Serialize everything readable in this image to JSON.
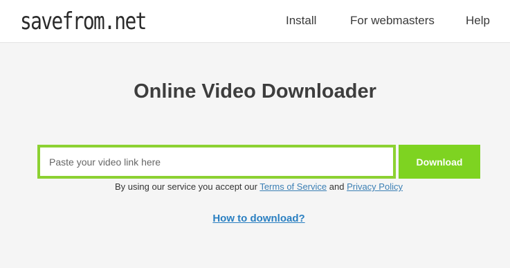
{
  "header": {
    "logo": "savefrom.net",
    "nav": [
      {
        "label": "Install"
      },
      {
        "label": "For webmasters"
      },
      {
        "label": "Help"
      }
    ]
  },
  "main": {
    "title": "Online Video Downloader",
    "input_placeholder": "Paste your video link here",
    "input_value": "",
    "download_label": "Download",
    "terms": {
      "prefix": "By using our service you accept our ",
      "tos_label": "Terms of Service",
      "conjunction": " and ",
      "privacy_label": "Privacy Policy"
    },
    "howto_label": "How to download?"
  },
  "colors": {
    "accent": "#7ed321",
    "input_border": "#8cd132",
    "link": "#3b7fb4"
  }
}
